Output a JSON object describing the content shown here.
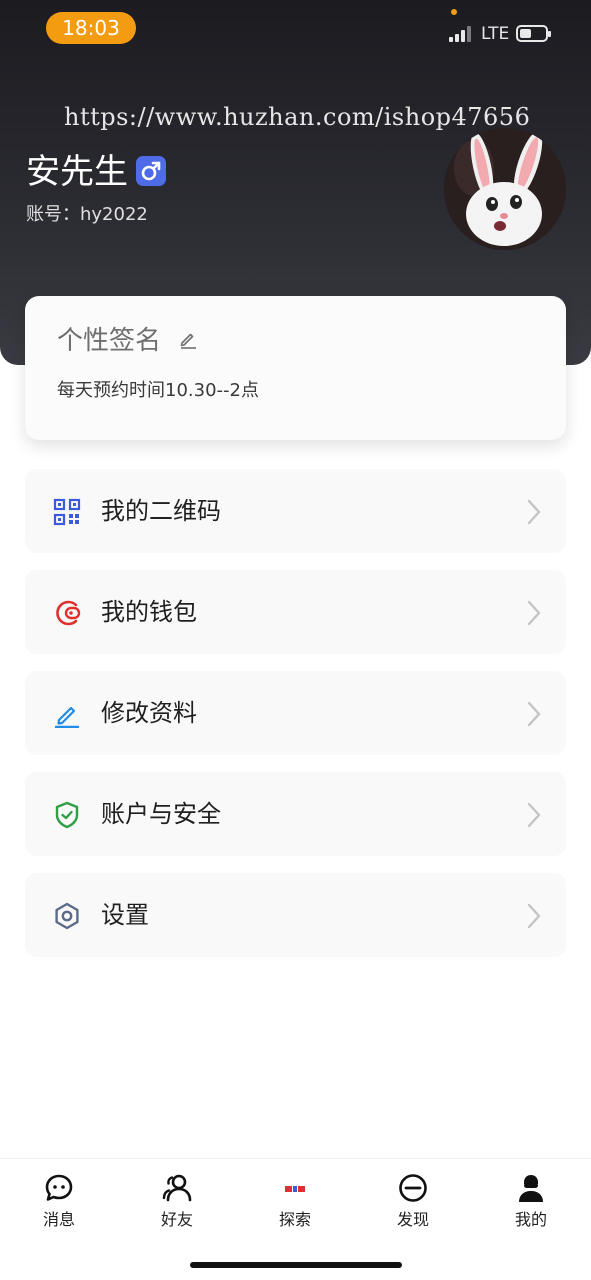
{
  "status_bar": {
    "time": "18:03",
    "network": "LTE"
  },
  "watermark": "https://www.huzhan.com/ishop47656",
  "profile": {
    "name": "安先生",
    "gender_icon": "male-icon",
    "account": "账号：hy2022"
  },
  "signature": {
    "title": "个性签名",
    "text": "每天预约时间10.30--2点"
  },
  "menu": [
    {
      "label": "我的二维码",
      "icon": "qr-code-icon",
      "color": "#3b5bdb"
    },
    {
      "label": "我的钱包",
      "icon": "wallet-icon",
      "color": "#e03131"
    },
    {
      "label": "修改资料",
      "icon": "edit-icon",
      "color": "#228be6"
    },
    {
      "label": "账户与安全",
      "icon": "shield-check-icon",
      "color": "#2f9e44"
    },
    {
      "label": "设置",
      "icon": "settings-icon",
      "color": "#5c6b8a"
    }
  ],
  "tabs": [
    {
      "label": "消息",
      "icon": "message-icon"
    },
    {
      "label": "好友",
      "icon": "friends-icon"
    },
    {
      "label": "探索",
      "icon": "baidu-icon"
    },
    {
      "label": "发现",
      "icon": "discover-icon"
    },
    {
      "label": "我的",
      "icon": "profile-icon",
      "active": true
    }
  ]
}
